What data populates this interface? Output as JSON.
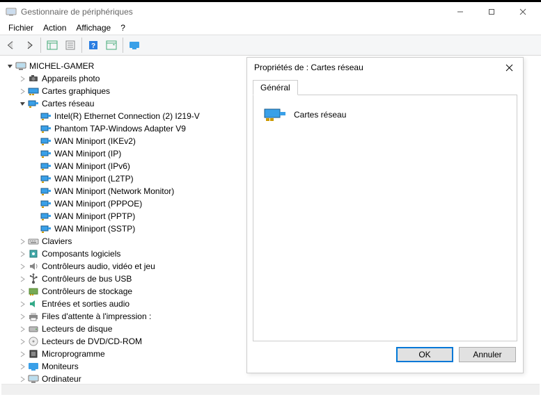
{
  "window": {
    "title": "Gestionnaire de périphériques"
  },
  "menu": {
    "file": "Fichier",
    "action": "Action",
    "view": "Affichage",
    "help": "?"
  },
  "tree": {
    "root": "MICHEL-GAMER",
    "cameras": "Appareils photo",
    "graphics": "Cartes graphiques",
    "network": {
      "label": "Cartes réseau",
      "items": [
        "Intel(R) Ethernet Connection (2) I219-V",
        "Phantom TAP-Windows Adapter V9",
        "WAN Miniport (IKEv2)",
        "WAN Miniport (IP)",
        "WAN Miniport (IPv6)",
        "WAN Miniport (L2TP)",
        "WAN Miniport (Network Monitor)",
        "WAN Miniport (PPPOE)",
        "WAN Miniport (PPTP)",
        "WAN Miniport (SSTP)"
      ]
    },
    "keyboards": "Claviers",
    "software_components": "Composants logiciels",
    "audio_video_game_controllers": "Contrôleurs audio, vidéo et jeu",
    "usb_controllers": "Contrôleurs de bus USB",
    "storage_controllers": "Contrôleurs de stockage",
    "audio_io": "Entrées et sorties audio",
    "print_queues": "Files d'attente à l'impression :",
    "disk_drives": "Lecteurs de disque",
    "dvd_drives": "Lecteurs de DVD/CD-ROM",
    "firmware": "Microprogramme",
    "monitors": "Moniteurs",
    "computer": "Ordinateur"
  },
  "dialog": {
    "title": "Propriétés de : Cartes réseau",
    "tab_general": "Général",
    "category_label": "Cartes réseau",
    "ok": "OK",
    "cancel": "Annuler"
  }
}
